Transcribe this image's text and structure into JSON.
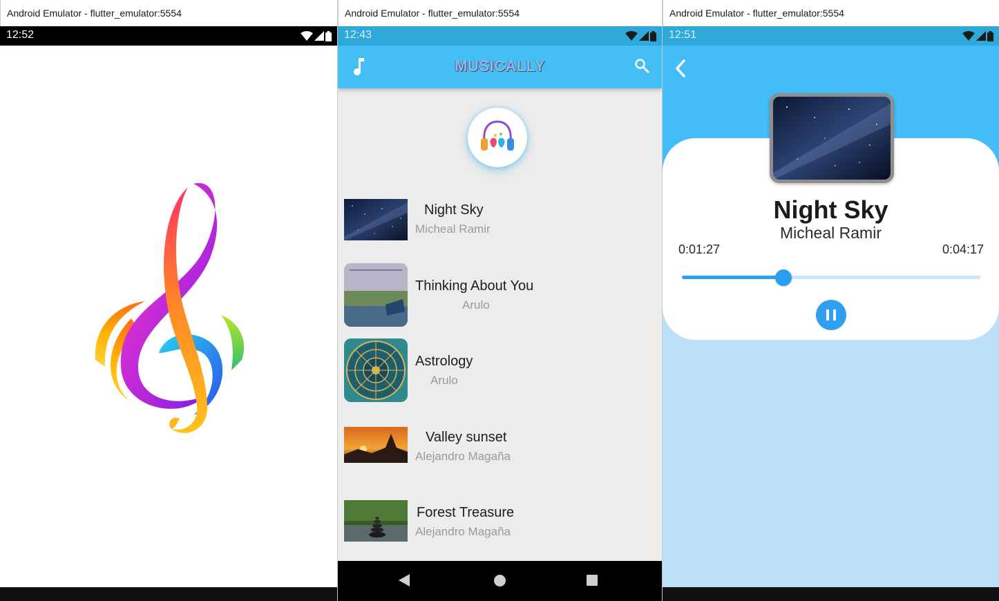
{
  "windows": [
    {
      "title": "Android Emulator - flutter_emulator:5554",
      "status_time": "12:52"
    },
    {
      "title": "Android Emulator - flutter_emulator:5554",
      "status_time": "12:43",
      "app_title": "MUSICALLY",
      "songs": [
        {
          "title": "Night Sky",
          "artist": "Micheal Ramir"
        },
        {
          "title": "Thinking About You",
          "artist": "Arulo"
        },
        {
          "title": "Astrology",
          "artist": "Arulo"
        },
        {
          "title": "Valley sunset",
          "artist": "Alejandro Magaña"
        },
        {
          "title": "Forest Treasure",
          "artist": "Alejandro Magaña"
        }
      ]
    },
    {
      "title": "Android Emulator - flutter_emulator:5554",
      "status_time": "12:51",
      "now_playing": {
        "title": "Night Sky",
        "artist": "Micheal Ramir",
        "elapsed": "0:01:27",
        "total": "0:04:17",
        "progress": 0.34
      }
    }
  ],
  "icons": {
    "splash": "treble-clef-logo",
    "appbar_left": "music-note-icon",
    "appbar_right": "search-icon",
    "app_logo": "headphones-logo",
    "player_back": "back-arrow-icon",
    "player_control": "pause-icon",
    "status": [
      "wifi-icon",
      "signal-icon",
      "battery-icon"
    ]
  },
  "colors": {
    "accent": "#44bff4",
    "status_bar_blue": "#2fa9da",
    "player_button": "#2f9ff2",
    "player_background": "#bde0f8"
  }
}
